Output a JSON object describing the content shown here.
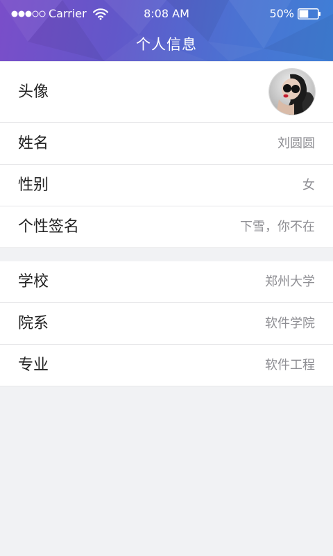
{
  "status_bar": {
    "carrier": "Carrier",
    "time": "8:08 AM",
    "battery_percent": "50%",
    "battery_level": 0.5,
    "signal_bars_filled": 3,
    "signal_bars_total": 5,
    "wifi_icon": "wifi-icon"
  },
  "header": {
    "title": "个人信息",
    "gradient_colors": [
      "#7a4ec9",
      "#6257c9",
      "#4b72d2",
      "#3f7fd6"
    ]
  },
  "profile_basic": [
    {
      "label": "头像",
      "type": "avatar",
      "icon": "avatar-photo"
    },
    {
      "label": "姓名",
      "value": "刘圆圆"
    },
    {
      "label": "性别",
      "value": "女"
    },
    {
      "label": "个性签名",
      "value": "下雪，你不在"
    }
  ],
  "profile_school": [
    {
      "label": "学校",
      "value": "郑州大学"
    },
    {
      "label": "院系",
      "value": "软件学院"
    },
    {
      "label": "专业",
      "value": "软件工程"
    }
  ],
  "colors": {
    "background": "#f1f2f4",
    "row_background": "#ffffff",
    "label_text": "#222222",
    "value_text": "#8e8e93",
    "divider": "#e6e6e8"
  }
}
